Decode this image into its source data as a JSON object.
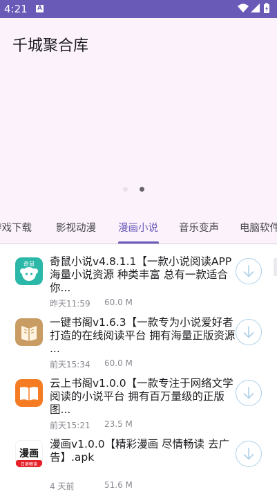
{
  "status": {
    "time": "4:21",
    "notification_badge": "A"
  },
  "app": {
    "title": "千城聚合库"
  },
  "carousel": {
    "page_count": 2,
    "active_index": 1
  },
  "tabs": [
    {
      "label": "游戏下载",
      "active": false
    },
    {
      "label": "影视动漫",
      "active": false
    },
    {
      "label": "漫画小说",
      "active": true
    },
    {
      "label": "音乐变声",
      "active": false
    },
    {
      "label": "电脑软件",
      "active": false
    }
  ],
  "items": [
    {
      "title": "奇鼠小说v4.8.1.1【一款小说阅读APP 海量小说资源 种类丰富 总有一款适合你...",
      "date": "昨天11:59",
      "size": "60.0 M",
      "icon": "mouse-reader-icon",
      "icon_text": "奇鼠"
    },
    {
      "title": "一键书阁v1.6.3【一款专为小说爱好者打造的在线阅读平台 拥有海量正版资源 ...",
      "date": "前天15:34",
      "size": "60.0 M",
      "icon": "book-icon"
    },
    {
      "title": "云上书阁v1.0.0【一款专注于网络文学阅读的小说平台 拥有百万量级的正版图...",
      "date": "前天15:21",
      "size": "23.5 M",
      "icon": "open-book-icon"
    },
    {
      "title": "漫画v1.0.0【精彩漫画 尽情畅读 去广告】.apk",
      "date": "4 天前",
      "size": "51.6 M",
      "icon": "manga-icon",
      "icon_text": "漫画",
      "icon_subtext": "日更畅读"
    }
  ],
  "colors": {
    "accent": "#6a5ab8",
    "header_bg": "#fbf2fc",
    "download_ring": "#aed0e8"
  }
}
